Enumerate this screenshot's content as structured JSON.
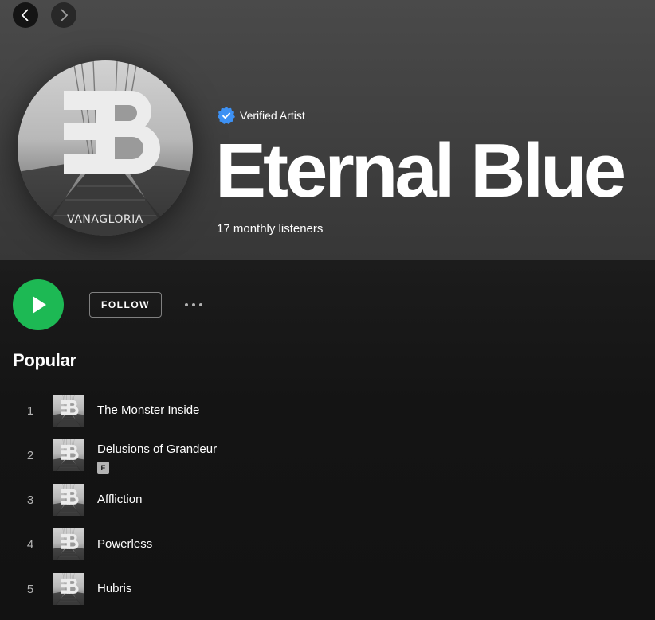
{
  "nav": {
    "back_icon": "chevron-left-icon",
    "forward_icon": "chevron-right-icon"
  },
  "artist": {
    "verified_label": "Verified Artist",
    "name": "Eternal Blue",
    "listeners": "17 monthly listeners",
    "avatar_text": "VANAGLORIA"
  },
  "controls": {
    "play_icon": "play-icon",
    "follow_label": "FOLLOW",
    "more_icon": "more-options-icon"
  },
  "popular": {
    "title": "Popular",
    "tracks": [
      {
        "number": "1",
        "title": "The Monster Inside",
        "explicit": false
      },
      {
        "number": "2",
        "title": "Delusions of Grandeur",
        "explicit": true,
        "explicit_label": "E"
      },
      {
        "number": "3",
        "title": "Affliction",
        "explicit": false
      },
      {
        "number": "4",
        "title": "Powerless",
        "explicit": false
      },
      {
        "number": "5",
        "title": "Hubris",
        "explicit": false
      }
    ]
  },
  "colors": {
    "accent": "#1db954",
    "verified": "#3d91f4",
    "background": "#121212",
    "secondary_text": "#b3b3b3"
  }
}
